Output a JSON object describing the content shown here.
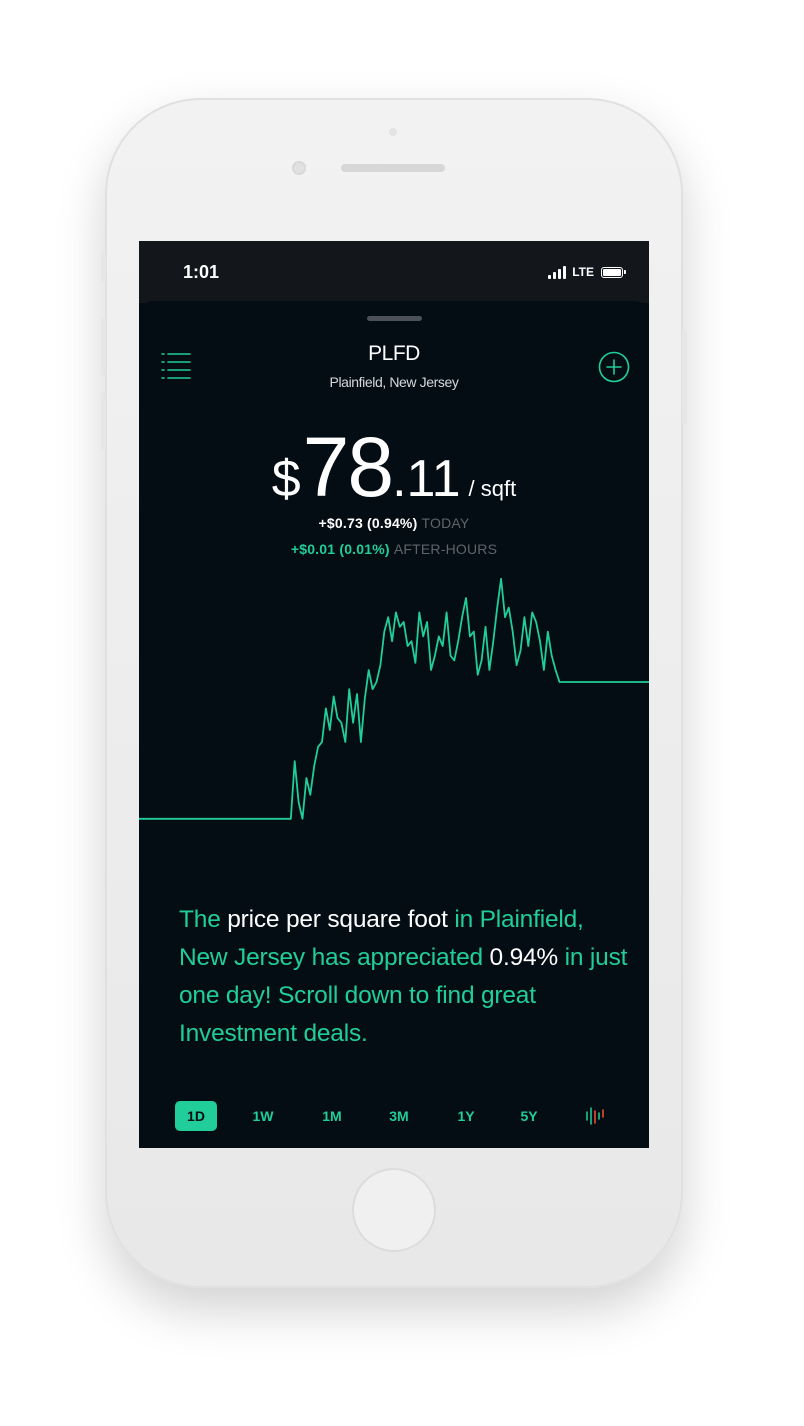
{
  "status_bar": {
    "time": "1:01",
    "network": "LTE"
  },
  "header": {
    "ticker": "PLFD",
    "location": "Plainfield, New Jersey",
    "menu_icon": "menu-icon",
    "add_icon": "plus-circle-icon"
  },
  "price": {
    "currency": "$",
    "integer": "78",
    "decimal": ".11",
    "unit": "/ sqft"
  },
  "changes": {
    "today_value": "+$0.73 (0.94%)",
    "today_label": "TODAY",
    "after_hours_value": "+$0.01 (0.01%)",
    "after_hours_label": "AFTER-HOURS"
  },
  "message": {
    "p1": "The ",
    "p2": "price per square foot",
    "p3": " in Plainfield, New Jersey has appreciated ",
    "p4": "0.94%",
    "p5": " in just one day! Scroll down to find great Investment deals."
  },
  "range_tabs": [
    "1D",
    "1W",
    "1M",
    "3M",
    "1Y",
    "5Y"
  ],
  "active_range": "1D",
  "colors": {
    "accent": "#21ce99",
    "background": "#040c14",
    "status_bar": "#13171c",
    "muted": "#5f656b"
  },
  "chart_data": {
    "type": "line",
    "title": "",
    "xlabel": "",
    "ylabel": "",
    "grid": false,
    "series": [
      {
        "values": [
          77.38,
          77.38,
          77.38,
          77.38,
          77.38,
          77.38,
          77.38,
          77.38,
          77.38,
          77.38,
          77.38,
          77.38,
          77.38,
          77.38,
          77.38,
          77.38,
          77.38,
          77.38,
          77.38,
          77.38,
          77.38,
          77.38,
          77.38,
          77.38,
          77.38,
          77.38,
          77.38,
          77.38,
          77.38,
          77.38,
          77.38,
          77.38,
          77.38,
          77.38,
          77.38,
          77.38,
          77.38,
          77.38,
          77.38,
          77.38,
          77.62,
          77.45,
          77.38,
          77.55,
          77.48,
          77.6,
          77.68,
          77.7,
          77.84,
          77.75,
          77.89,
          77.8,
          77.78,
          77.7,
          77.92,
          77.78,
          77.9,
          77.7,
          77.88,
          78.0,
          77.92,
          77.95,
          78.02,
          78.16,
          78.22,
          78.12,
          78.24,
          78.18,
          78.2,
          78.1,
          78.12,
          78.03,
          78.24,
          78.14,
          78.2,
          78.0,
          78.06,
          78.14,
          78.1,
          78.24,
          78.06,
          78.04,
          78.12,
          78.22,
          78.3,
          78.14,
          78.16,
          77.98,
          78.04,
          78.18,
          78.0,
          78.12,
          78.26,
          78.38,
          78.22,
          78.26,
          78.16,
          78.02,
          78.08,
          78.22,
          78.1,
          78.24,
          78.2,
          78.12,
          78.0,
          78.16,
          78.06,
          78.0,
          77.95,
          77.95,
          77.95,
          77.95,
          77.95,
          77.95,
          77.95,
          77.95,
          77.95,
          77.95,
          77.95,
          77.95,
          77.95,
          77.95,
          77.95,
          77.95,
          77.95,
          77.95,
          77.95,
          77.95,
          77.95,
          77.95,
          77.95,
          77.95
        ]
      }
    ],
    "ylim": [
      77.3,
      78.4
    ]
  }
}
